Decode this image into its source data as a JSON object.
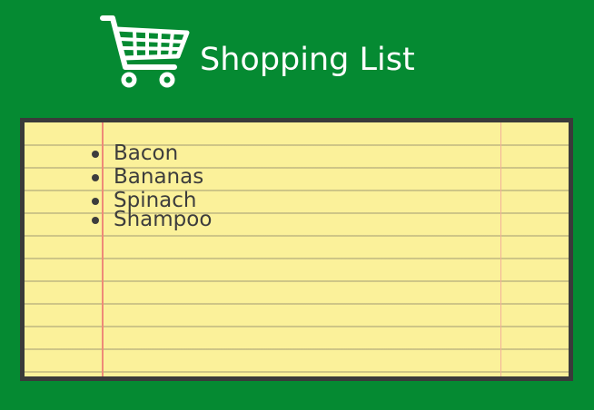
{
  "header": {
    "title": "Shopping List",
    "icon": "shopping-cart-icon"
  },
  "list": {
    "items": [
      "Bacon",
      "Bananas",
      "Spinach",
      "Shampoo"
    ]
  },
  "colors": {
    "background": "#058a32",
    "paper": "#fbf19a",
    "border": "#3a3a3a",
    "margin_line": "#ee8a78",
    "text": "#3d3d3d",
    "title": "#ffffff"
  }
}
